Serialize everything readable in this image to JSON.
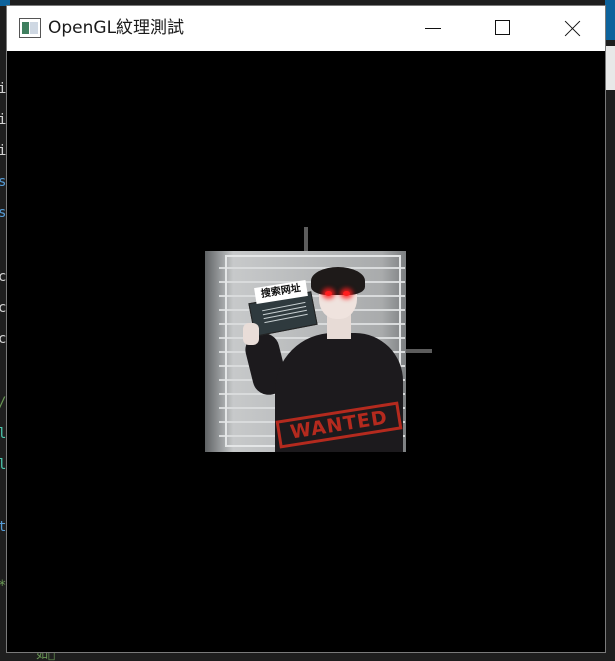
{
  "window": {
    "title": "OpenGL紋理測試",
    "caption_buttons": [
      "minimize",
      "maximize",
      "close"
    ]
  },
  "viewport": {
    "background_color": "#000000",
    "axis_line_color": "#5c5c5c",
    "texture": {
      "sign_text": "搜索网址",
      "stamp_text": "WANTED",
      "stamp_color": "#b42a1e",
      "eye_glow_color": "#ff1e1e"
    }
  },
  "background_editor": {
    "left_glyphs": [
      {
        "text": "i",
        "color": "#d4d4d4"
      },
      {
        "text": "i",
        "color": "#d4d4d4"
      },
      {
        "text": "i",
        "color": "#d4d4d4"
      },
      {
        "text": "s",
        "color": "#569cd6"
      },
      {
        "text": "s",
        "color": "#569cd6"
      },
      {
        "text": "c",
        "color": "#d4d4d4"
      },
      {
        "text": "c",
        "color": "#d4d4d4"
      },
      {
        "text": "c",
        "color": "#d4d4d4"
      },
      {
        "text": "/",
        "color": "#6a9955"
      },
      {
        "text": "l",
        "color": "#4ec9b0"
      },
      {
        "text": "l",
        "color": "#4ec9b0"
      },
      {
        "text": "t",
        "color": "#569cd6"
      },
      {
        "text": "*",
        "color": "#6a9955"
      }
    ],
    "bottom_text": "如\u0000"
  },
  "icons": {
    "app": "window-app-icon",
    "minimize": "minimize-icon",
    "maximize": "maximize-icon",
    "close": "close-icon"
  }
}
